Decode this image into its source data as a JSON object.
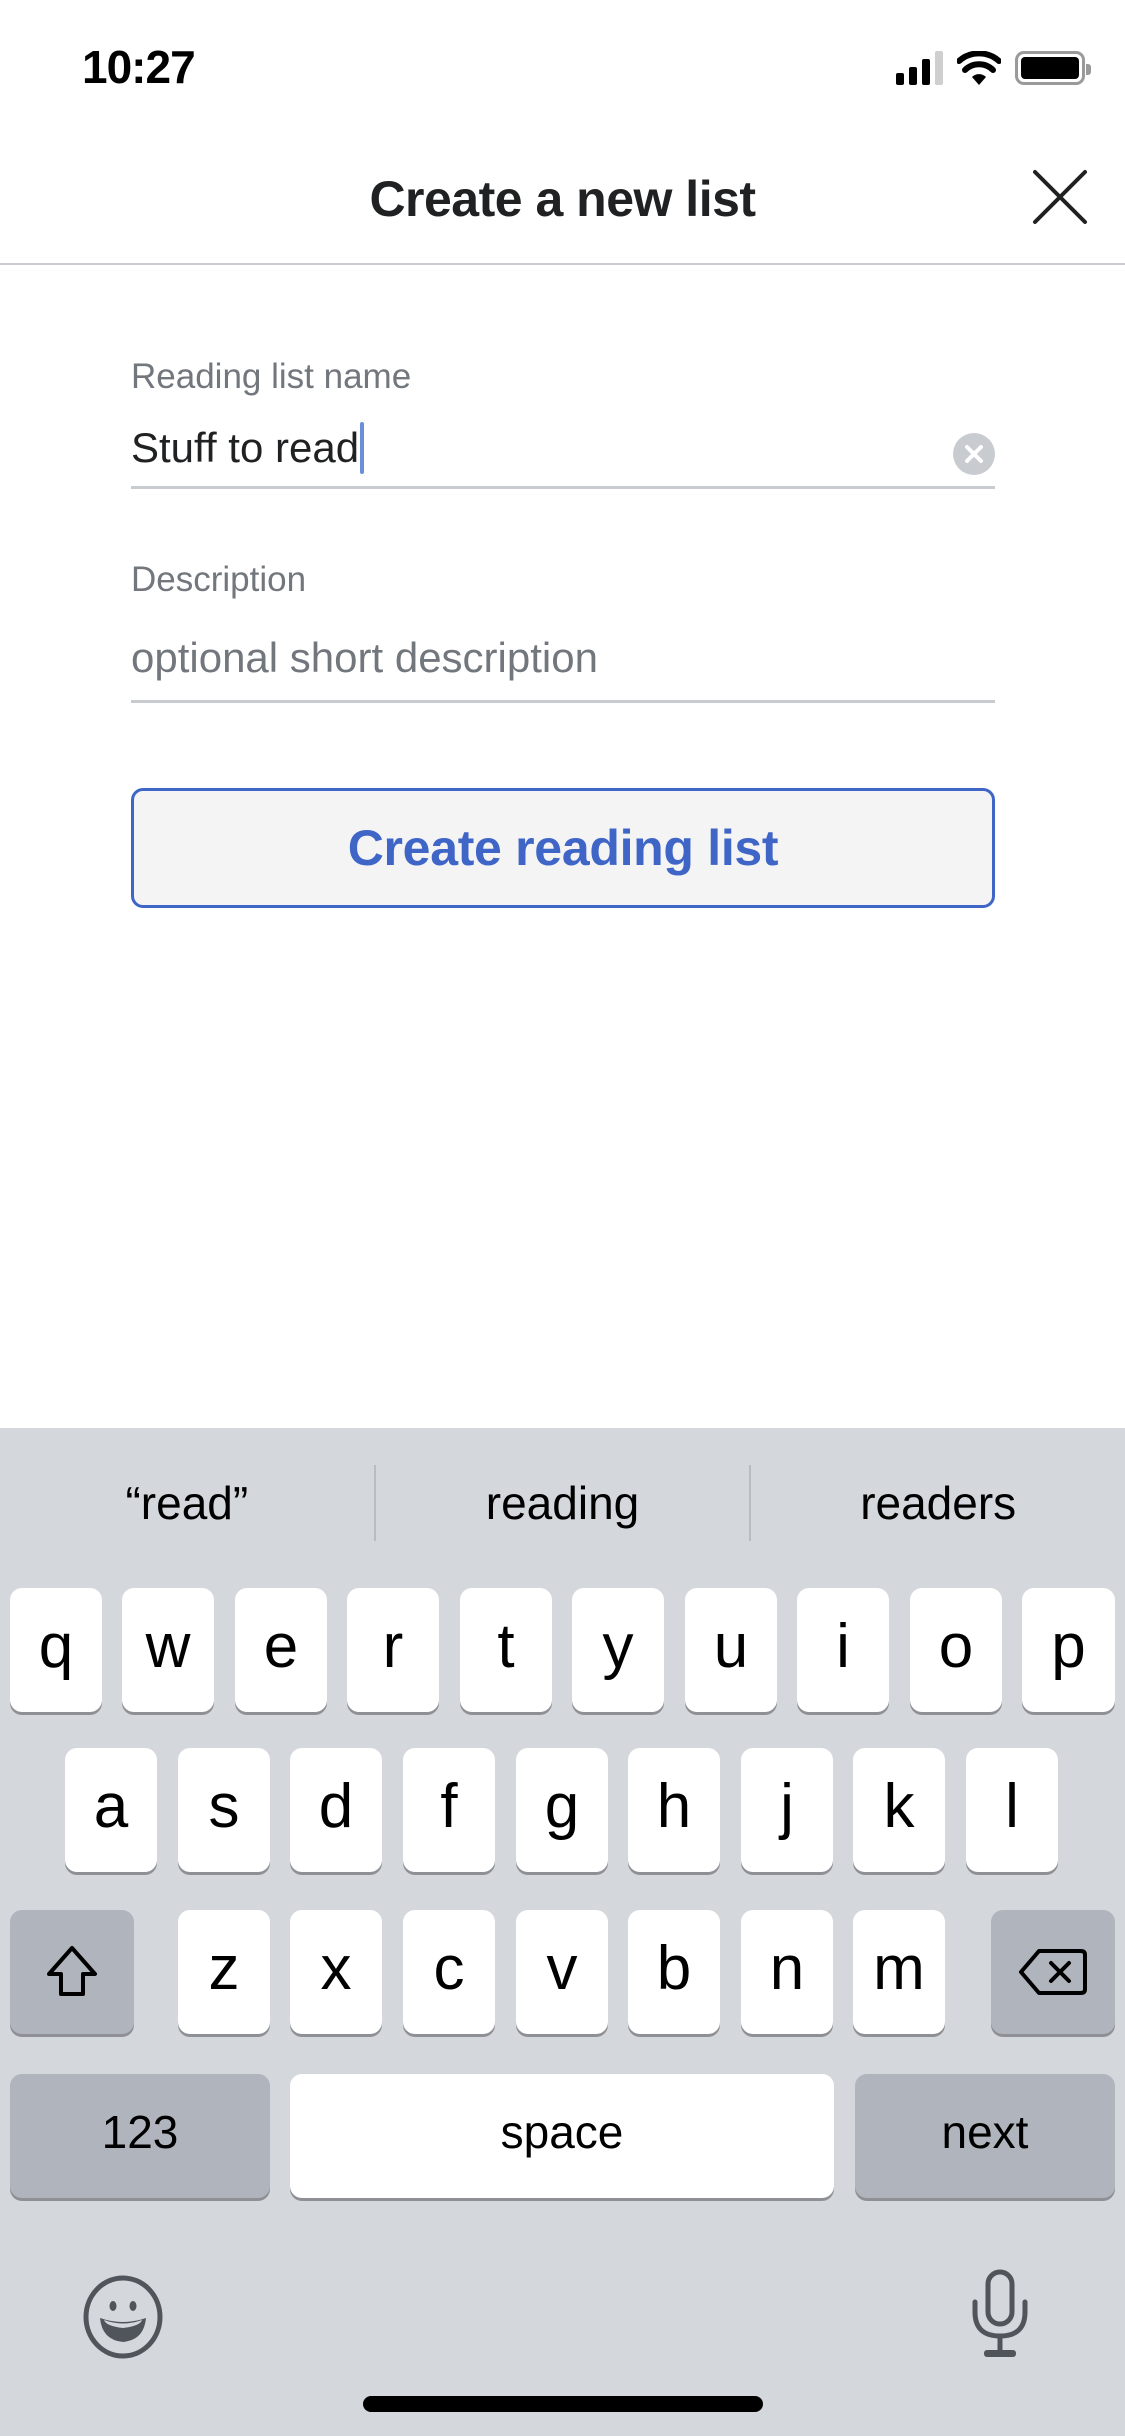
{
  "status_bar": {
    "time": "10:27",
    "icons": [
      "signal-icon",
      "wifi-icon",
      "battery-icon"
    ]
  },
  "header": {
    "title": "Create a new list",
    "close_icon": "close-icon"
  },
  "form": {
    "name_field": {
      "label": "Reading list name",
      "value": "Stuff to read",
      "clear_icon": "clear-circle-icon"
    },
    "description_field": {
      "label": "Description",
      "value": "",
      "placeholder": "optional short description"
    },
    "submit_label": "Create reading list"
  },
  "colors": {
    "accent": "#3f66c7",
    "label_gray": "#72777d",
    "divider": "#c8ccd1",
    "keyboard_bg": "#d4d7dc",
    "dark_key": "#b0b4bc",
    "caret": "#6b8fd6"
  },
  "keyboard": {
    "suggestions": [
      "“read”",
      "reading",
      "readers"
    ],
    "row1": [
      "q",
      "w",
      "e",
      "r",
      "t",
      "y",
      "u",
      "i",
      "o",
      "p"
    ],
    "row2": [
      "a",
      "s",
      "d",
      "f",
      "g",
      "h",
      "j",
      "k",
      "l"
    ],
    "row3": [
      "z",
      "x",
      "c",
      "v",
      "b",
      "n",
      "m"
    ],
    "shift_icon": "shift-icon",
    "delete_icon": "backspace-icon",
    "numbers_label": "123",
    "space_label": "space",
    "return_label": "next",
    "emoji_icon": "emoji-icon",
    "mic_icon": "microphone-icon"
  }
}
